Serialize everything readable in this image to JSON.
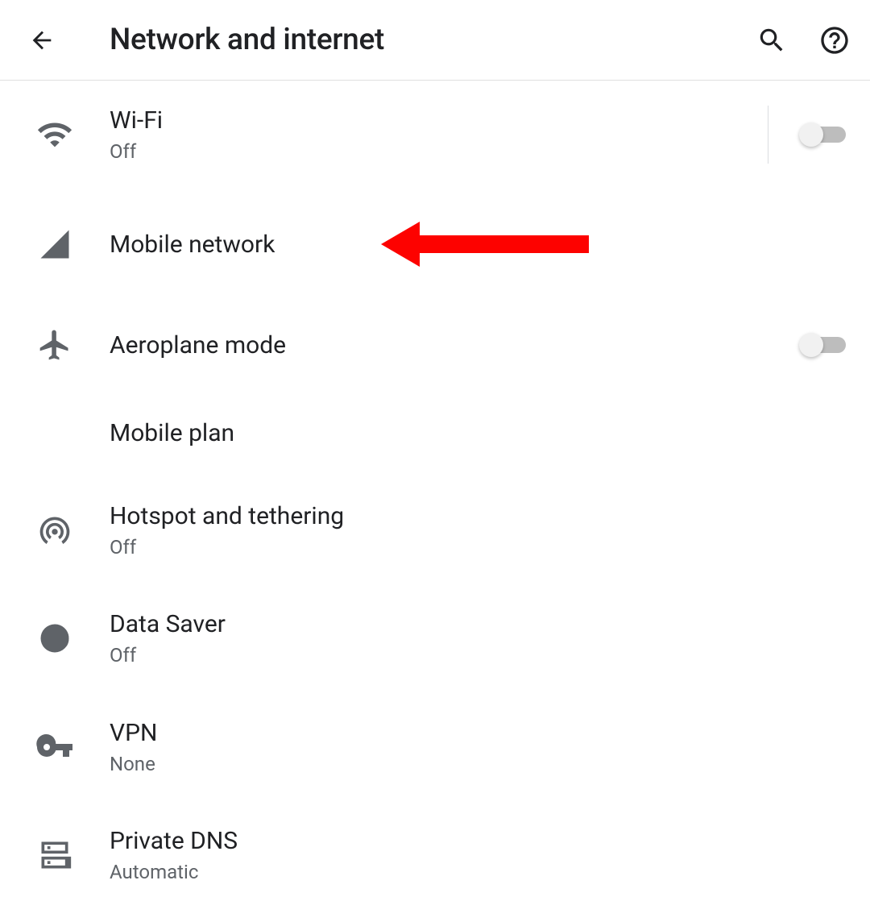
{
  "header": {
    "title": "Network and internet"
  },
  "items": {
    "wifi": {
      "title": "Wi-Fi",
      "sub": "Off"
    },
    "mobile": {
      "title": "Mobile network"
    },
    "air": {
      "title": "Aeroplane mode"
    },
    "plan": {
      "title": "Mobile plan"
    },
    "hotspot": {
      "title": "Hotspot and tethering",
      "sub": "Off"
    },
    "saver": {
      "title": "Data Saver",
      "sub": "Off"
    },
    "vpn": {
      "title": "VPN",
      "sub": "None"
    },
    "dns": {
      "title": "Private DNS",
      "sub": "Automatic"
    }
  },
  "toggles": {
    "wifi": false,
    "aeroplane": false
  },
  "annotation": {
    "points_to": "mobile-network",
    "color": "#fd0200"
  }
}
